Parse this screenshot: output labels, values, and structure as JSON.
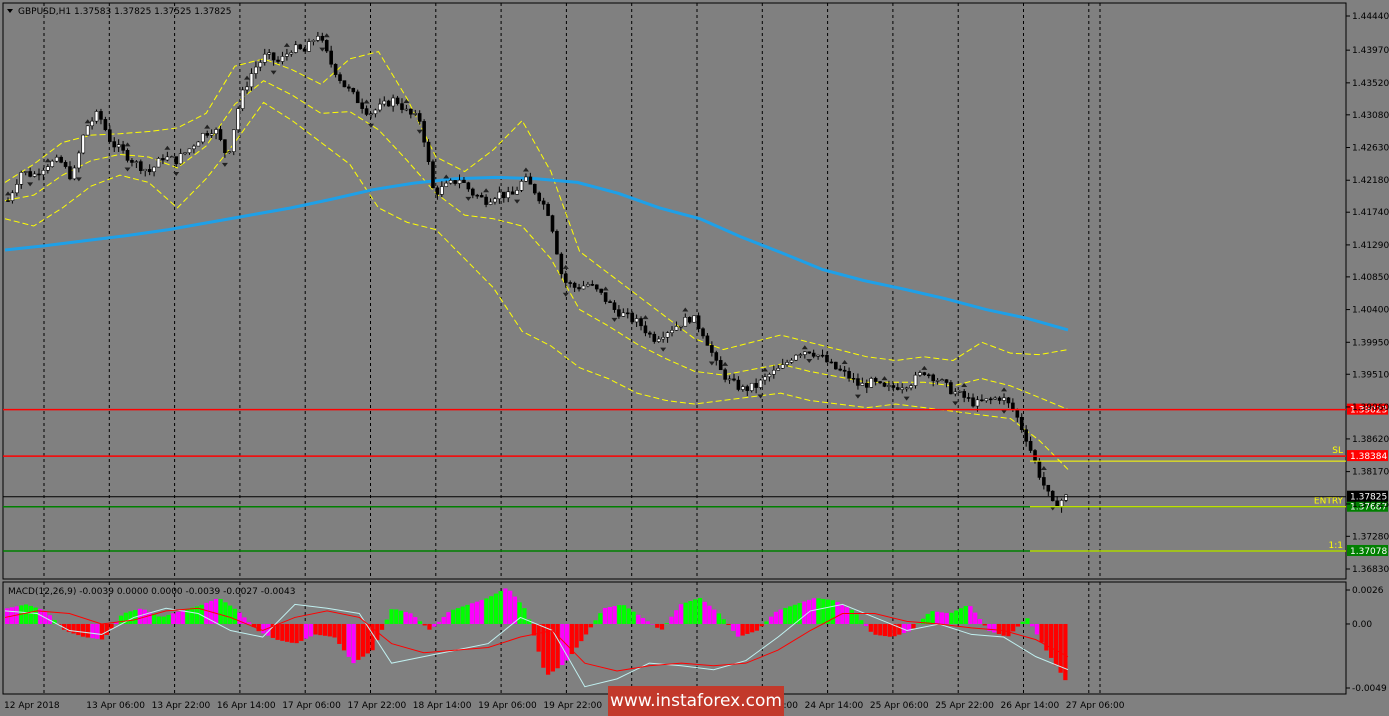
{
  "symbol_header": "GBPUSD,H1  1.37583 1.37825 1.37525 1.37825",
  "macd_header": "MACD(12,26,9) -0.0039 0.0000 0.0000 -0.0039 -0.0027 -0.0043",
  "watermark": "www.instaforex.com",
  "colors": {
    "background": "#808080",
    "candle_up": "#ffffff",
    "candle_down": "#000000",
    "ma": "#1ea0e8",
    "bollinger": "#ffff00",
    "resistance": "#ff0000",
    "support": "#008000",
    "macd_positive": "#00ff00",
    "macd_negative": "#ff0000",
    "macd_magenta": "#ff00ff"
  },
  "chart_data": [
    {
      "type": "candlestick",
      "title": "GBPUSD,H1",
      "ylim": [
        1.3683,
        1.4444
      ],
      "y_ticks": [
        "1.44440",
        "1.43970",
        "1.43520",
        "1.43080",
        "1.42630",
        "1.42180",
        "1.41740",
        "1.41290",
        "1.40850",
        "1.40400",
        "1.39950",
        "1.39510",
        "1.39060",
        "1.38620",
        "1.38170",
        "1.37725",
        "1.37280",
        "1.36830"
      ],
      "x_ticks": [
        "12 Apr 2018",
        "13 Apr 06:00",
        "13 Apr 22:00",
        "16 Apr 14:00",
        "17 Apr 06:00",
        "17 Apr 22:00",
        "18 Apr 14:00",
        "19 Apr 06:00",
        "19 Apr 22:00",
        "20 Apr 14:00",
        "23 Apr 06:00",
        "23 Apr 22:00",
        "24 Apr 14:00",
        "25 Apr 06:00",
        "25 Apr 22:00",
        "26 Apr 14:00",
        "27 Apr 06:00"
      ],
      "close_path": [
        1.419,
        1.423,
        1.4225,
        1.424,
        1.4245,
        1.422,
        1.429,
        1.431,
        1.427,
        1.4255,
        1.424,
        1.423,
        1.425,
        1.4245,
        1.426,
        1.428,
        1.429,
        1.425,
        1.433,
        1.437,
        1.439,
        1.438,
        1.44,
        1.4395,
        1.442,
        1.438,
        1.435,
        1.433,
        1.431,
        1.432,
        1.433,
        1.431,
        1.43,
        1.42,
        1.421,
        1.422,
        1.42,
        1.419,
        1.42,
        1.4195,
        1.422,
        1.42,
        1.417,
        1.408,
        1.407,
        1.4075,
        1.406,
        1.404,
        1.403,
        1.402,
        1.4,
        1.401,
        1.402,
        1.403,
        1.4005,
        1.396,
        1.394,
        1.393,
        1.3935,
        1.395,
        1.396,
        1.398,
        1.3985,
        1.3975,
        1.396,
        1.395,
        1.3935,
        1.394,
        1.393,
        1.3935,
        1.394,
        1.3955,
        1.3945,
        1.393,
        1.392,
        1.391,
        1.3915,
        1.392,
        1.39,
        1.386,
        1.381,
        1.377,
        1.3782
      ],
      "moving_average": [
        1.4122,
        1.4128,
        1.4135,
        1.4142,
        1.415,
        1.416,
        1.417,
        1.418,
        1.4192,
        1.4205,
        1.4214,
        1.422,
        1.4222,
        1.422,
        1.4215,
        1.42,
        1.418,
        1.4165,
        1.414,
        1.4118,
        1.4095,
        1.408,
        1.4068,
        1.4055,
        1.404,
        1.4028,
        1.4012
      ],
      "bollinger_upper": [
        1.4215,
        1.424,
        1.427,
        1.428,
        1.4282,
        1.4285,
        1.429,
        1.431,
        1.4375,
        1.4385,
        1.437,
        1.435,
        1.4385,
        1.4395,
        1.433,
        1.425,
        1.423,
        1.426,
        1.43,
        1.423,
        1.412,
        1.409,
        1.406,
        1.403,
        1.4,
        1.3985,
        1.3995,
        1.4005,
        1.3995,
        1.3985,
        1.3975,
        1.397,
        1.3975,
        1.397,
        1.3995,
        1.398,
        1.3978,
        1.3985
      ],
      "bollinger_lower": [
        1.4165,
        1.4155,
        1.418,
        1.421,
        1.4225,
        1.4215,
        1.418,
        1.422,
        1.427,
        1.4325,
        1.43,
        1.427,
        1.424,
        1.418,
        1.416,
        1.415,
        1.411,
        1.407,
        1.401,
        1.399,
        1.396,
        1.3945,
        1.3925,
        1.3915,
        1.391,
        1.3915,
        1.392,
        1.3925,
        1.3915,
        1.391,
        1.3905,
        1.391,
        1.3905,
        1.39,
        1.3895,
        1.389,
        1.386,
        1.382
      ],
      "levels": [
        {
          "price": 1.39023,
          "label": "1.39023",
          "color": "#ff0000"
        },
        {
          "price": 1.38384,
          "label": "1.38384",
          "color": "#ff0000",
          "tag": "SL"
        },
        {
          "price": 1.37687,
          "label": "1.37687",
          "color": "#008000",
          "tag": "ENTRY"
        },
        {
          "price": 1.37078,
          "label": "1.37078",
          "color": "#008000",
          "tag": "1:1"
        }
      ],
      "current_price": {
        "price": 1.37825,
        "label": "1.37825"
      }
    },
    {
      "type": "bar",
      "title": "MACD(12,26,9)",
      "ylim": [
        -0.0049,
        0.0026
      ],
      "y_ticks": [
        "0.0026",
        "0.00",
        "-0.0049"
      ],
      "histogram": [
        0.0012,
        0.0015,
        0.001,
        -0.0005,
        -0.001,
        -0.0012,
        0.0008,
        0.0012,
        0.0005,
        0.001,
        0.0014,
        0.002,
        0.001,
        -0.0005,
        -0.0012,
        -0.0015,
        -0.0008,
        -0.001,
        -0.003,
        -0.002,
        0.0012,
        0.0008,
        -0.0005,
        0.001,
        0.0015,
        0.002,
        0.0028,
        0.001,
        -0.004,
        -0.003,
        -0.001,
        0.0012,
        0.0015,
        0.0005,
        -0.0005,
        0.0015,
        0.002,
        0.0008,
        -0.001,
        -0.0005,
        0.001,
        0.0015,
        0.002,
        0.0018,
        0.001,
        -0.0008,
        -0.001,
        -0.0005,
        0.001,
        0.0008,
        0.0015,
        -0.0005,
        -0.001,
        0.0005,
        -0.002,
        -0.0043
      ],
      "macd_line": [
        0.001,
        0.0008,
        -0.0005,
        -0.0008,
        0.0005,
        0.0012,
        0.0008,
        -0.0005,
        -0.001,
        0.0015,
        0.0012,
        0.0008,
        -0.003,
        -0.0025,
        -0.002,
        -0.0015,
        0.0005,
        -0.0005,
        -0.0048,
        -0.0042,
        -0.003,
        -0.0032,
        -0.0035,
        -0.0028,
        -0.001,
        0.001,
        0.0015,
        0.0005,
        -0.0005,
        0.0,
        -0.0008,
        -0.001,
        -0.0025,
        -0.0035
      ],
      "signal_line": [
        0.0005,
        0.001,
        0.0008,
        0.0,
        0.0003,
        0.001,
        0.0012,
        0.0005,
        -0.0005,
        0.0005,
        0.001,
        0.0005,
        -0.0015,
        -0.0022,
        -0.002,
        -0.0018,
        -0.001,
        -0.0005,
        -0.003,
        -0.0036,
        -0.0032,
        -0.003,
        -0.0032,
        -0.003,
        -0.002,
        -0.0005,
        0.0008,
        0.0008,
        0.0002,
        0.0,
        -0.0003,
        -0.0005,
        -0.0012,
        -0.0025
      ]
    }
  ]
}
